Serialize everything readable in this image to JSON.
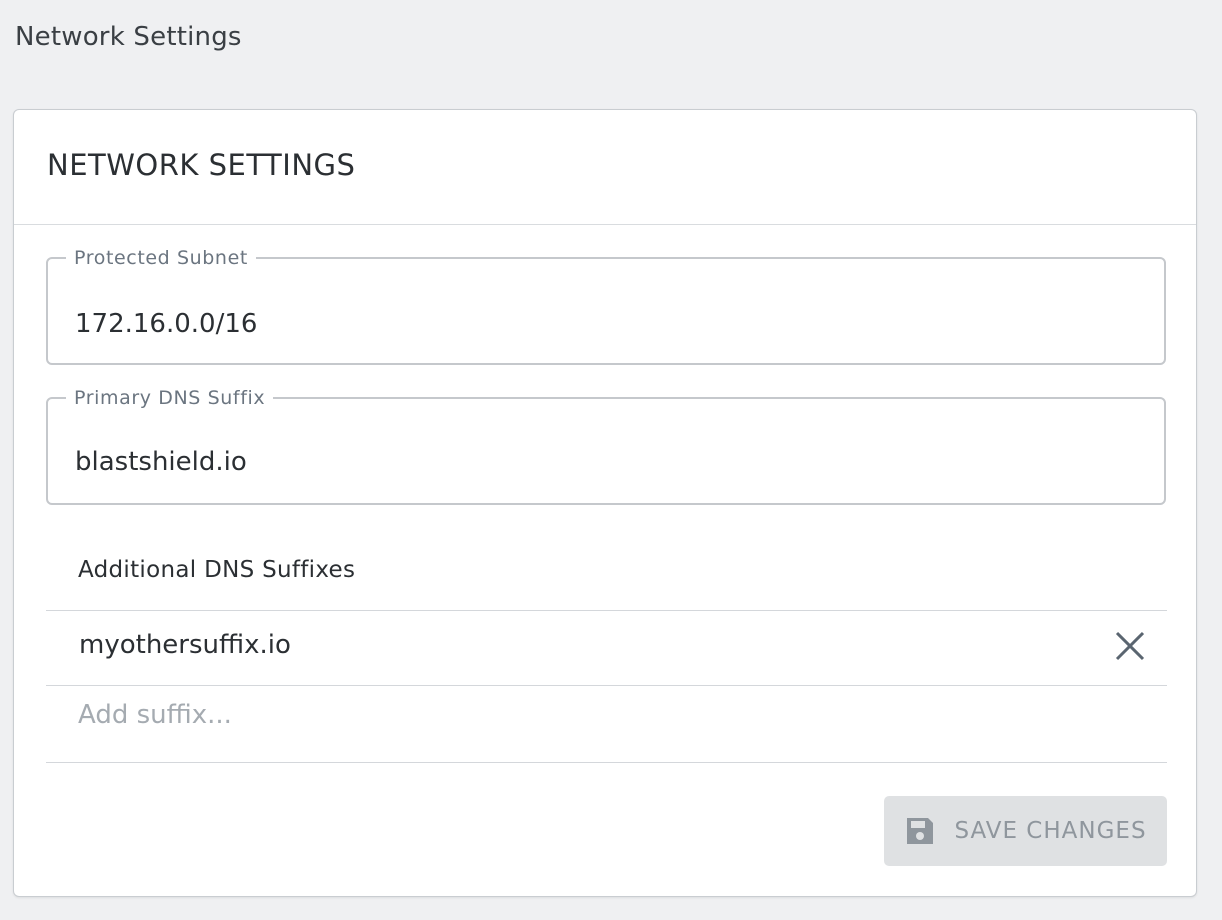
{
  "page": {
    "title": "Network Settings"
  },
  "card": {
    "title": "NETWORK SETTINGS",
    "protected_subnet": {
      "label": "Protected Subnet",
      "value": "172.16.0.0/16"
    },
    "primary_dns_suffix": {
      "label": "Primary DNS Suffix",
      "value": "blastshield.io"
    },
    "additional_dns": {
      "label": "Additional DNS Suffixes",
      "items": [
        {
          "value": "myothersuffix.io",
          "remove_icon": "close-icon"
        }
      ],
      "add_placeholder": "Add suffix..."
    },
    "save_button": {
      "label": "SAVE CHANGES",
      "icon": "floppy-disk-icon",
      "state": "disabled"
    }
  },
  "colors": {
    "background": "#eff0f2",
    "card": "#ffffff",
    "text": "#2b2f33",
    "muted_label": "#6b7580",
    "button_disabled_bg": "#dfe1e3",
    "button_disabled_text": "#8f969d"
  }
}
